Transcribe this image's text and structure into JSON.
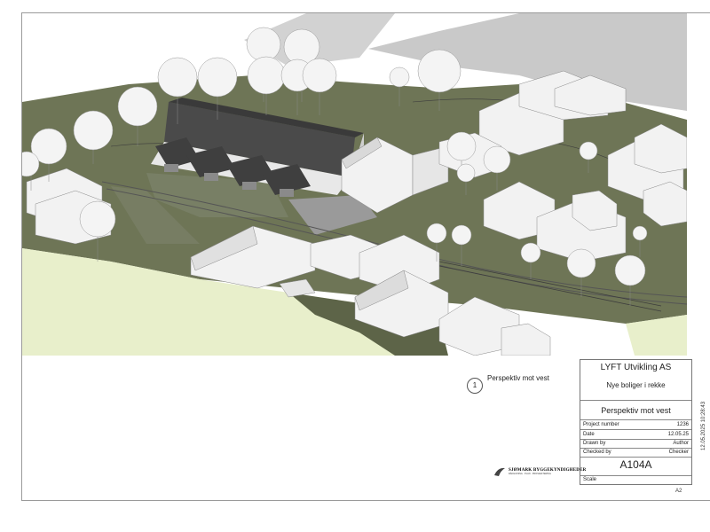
{
  "view": {
    "number": "1",
    "title": "Perspektiv mot vest"
  },
  "titleblock": {
    "client": "LYFT Utvikling AS",
    "project_name": "Nye boliger i rekke",
    "view_name": "Perspektiv mot vest",
    "rows": [
      {
        "label": "Project number",
        "value": "1236"
      },
      {
        "label": "Date",
        "value": "12.05.25"
      },
      {
        "label": "Drawn by",
        "value": "Author"
      },
      {
        "label": "Checked by",
        "value": "Checker"
      }
    ],
    "sheet_number": "A104A",
    "scale_label": "Scale"
  },
  "sheet_size": "A2",
  "timestamp": "12.05.2025 10:28:43",
  "logo": {
    "name": "SJØMARK BYGGEKYNDIGHEDER",
    "tagline": "RÅDGIVNING · PLAN · PROSJEKTERING"
  },
  "colors": {
    "terrain": "#6e7556",
    "terrain_light": "#e8efcb",
    "shadow": "#c9c9c9",
    "roof_dark": "#4a4a4a",
    "building": "#f2f2f2"
  }
}
